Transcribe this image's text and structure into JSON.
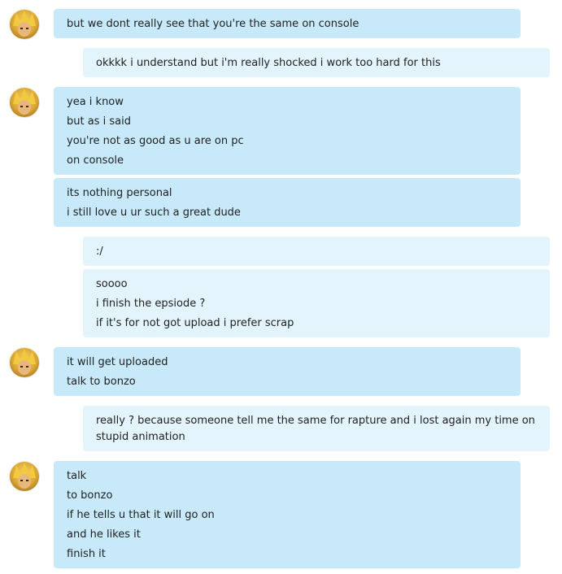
{
  "colors": {
    "incoming_bubble": "#c7e9fa",
    "outgoing_bubble": "#e3f4fc",
    "text": "#222222"
  },
  "messages": [
    {
      "sender": "them",
      "lines": [
        "but we dont really see that you're the same on console"
      ]
    },
    {
      "sender": "me",
      "lines": [
        "okkkk i understand but i'm really shocked i work too hard for this"
      ]
    },
    {
      "sender": "them",
      "lines": [
        "yea i know",
        "but as i said",
        "you're not as good as u are on pc",
        "on console"
      ]
    },
    {
      "sender": "them",
      "lines": [
        "its nothing personal",
        "i still love u ur such a great dude"
      ]
    },
    {
      "sender": "me",
      "lines": [
        ":/"
      ]
    },
    {
      "sender": "me",
      "lines": [
        "soooo",
        "i finish the epsiode ?",
        "if it's for not got upload i prefer scrap"
      ]
    },
    {
      "sender": "them",
      "lines": [
        "it will get uploaded",
        "talk to bonzo"
      ]
    },
    {
      "sender": "me",
      "lines": [
        "really ? because someone tell me the same for rapture and i lost again my time on stupid animation"
      ]
    },
    {
      "sender": "them",
      "lines": [
        "talk",
        "to bonzo",
        "if he tells u that it will go on",
        "and he likes it",
        "finish it"
      ]
    }
  ]
}
